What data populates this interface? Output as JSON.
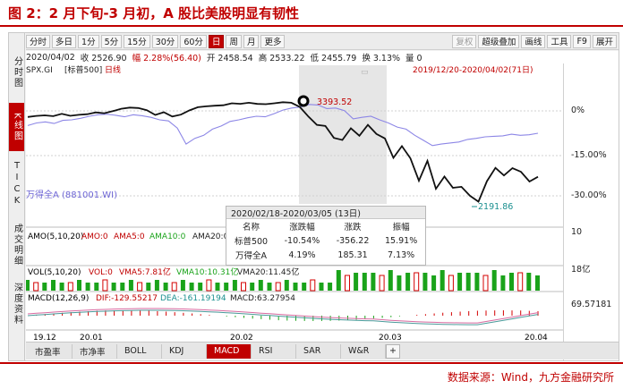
{
  "figure_title": "图 2：2 月下旬-3 月初，A 股比美股明显有韧性",
  "source": "数据来源：Wind，九方金融研究所",
  "sidebar": [
    {
      "label": "分时图",
      "active": false
    },
    {
      "label": "K线图",
      "active": true
    },
    {
      "label": "TICK",
      "active": false
    },
    {
      "label": "成交明细",
      "active": false
    },
    {
      "label": "深度资料",
      "active": false
    }
  ],
  "toolbar": {
    "left": [
      "分时",
      "多日",
      "1分",
      "5分",
      "15分",
      "30分",
      "60分",
      "日",
      "周",
      "月",
      "更多"
    ],
    "selected": "日",
    "right": [
      {
        "label": "复权",
        "disabled": true
      },
      {
        "label": "超级叠加",
        "disabled": false
      },
      {
        "label": "画线",
        "disabled": false
      },
      {
        "label": "工具",
        "disabled": false
      },
      {
        "label": "F9",
        "disabled": false
      },
      {
        "label": "展开",
        "disabled": false
      }
    ]
  },
  "info": {
    "date": "2020/04/02",
    "close": "收 2526.90",
    "change": "幅 2.28%(56.40)",
    "open": "开 2458.54",
    "high": "高 2533.22",
    "low": "低 2455.79",
    "turnover": "换 3.13%",
    "volume": "量 0"
  },
  "chart_header": {
    "series_id": "SPX.GI",
    "series_name": "[标普500]",
    "period": "日线",
    "range": "2019/12/20-2020/04/02(71日)"
  },
  "overlay_label": "万得全A (881001.WI)",
  "annotations": {
    "high": "3393.52",
    "low": "2191.86"
  },
  "right_axis": {
    "pct_ticks": [
      "0%",
      "-15.00%",
      "-30.00%"
    ],
    "vol_tick": "10",
    "vol_unit": "18亿",
    "macd_tick": "69.57181"
  },
  "amo_label": {
    "name": "AMO(5,10,20)",
    "amo0": "AMO:0",
    "amo5": "AMA5:0",
    "amo10": "AMA10:0",
    "amo20": "AMA20:0"
  },
  "vol_label": {
    "name": "VOL(5,10,20)",
    "vol0": "VOL:0",
    "vma5": "VMA5:7.81亿",
    "vma10": "VMA10:10.31亿",
    "vma20": "VMA20:11.45亿"
  },
  "macd_label": {
    "name": "MACD(12,26,9)",
    "dif": "DIF:-129.55217",
    "dea": "DEA:-161.19194",
    "macd": "MACD:63.27954"
  },
  "x_axis": [
    "19.12",
    "20.01",
    "20.02",
    "20.03",
    "20.04"
  ],
  "popup": {
    "title": "2020/02/18-2020/03/05 (13日)",
    "headers": [
      "名称",
      "涨跌幅",
      "涨跌",
      "振幅"
    ],
    "rows": [
      [
        "标普500",
        "-10.54%",
        "-356.22",
        "15.91%"
      ],
      [
        "万得全A",
        "4.19%",
        "185.31",
        "7.13%"
      ]
    ]
  },
  "bottom_tabs": [
    "市盈率",
    "市净率",
    "BOLL",
    "KDJ",
    "MACD",
    "RSI",
    "SAR",
    "W&R"
  ],
  "bottom_selected": "MACD",
  "colors": {
    "accent": "#c00000",
    "spx_line": "#111111",
    "wind_line": "#8c86e6",
    "vol_bar": "#1aa31a",
    "vol_bar_up": "#d40000",
    "selection": "#d6d6d6"
  },
  "chart_data": {
    "type": "line",
    "series": [
      {
        "name": "标普500",
        "values": [
          3221,
          3234,
          3240,
          3230,
          3257,
          3235,
          3246,
          3253,
          3274,
          3265,
          3289,
          3317,
          3330,
          3325,
          3300,
          3245,
          3276,
          3226,
          3248,
          3297,
          3334,
          3345,
          3352,
          3357,
          3380,
          3374,
          3386,
          3373,
          3370,
          3380,
          3393,
          3386,
          3337,
          3226,
          3128,
          3116,
          2978,
          2954,
          3090,
          3003,
          3130,
          3024,
          2972,
          2746,
          2882,
          2741,
          2480,
          2711,
          2386,
          2529,
          2398,
          2409,
          2305,
          2237,
          2475,
          2630,
          2541,
          2626,
          2584,
          2470,
          2526
        ]
      },
      {
        "name": "万得全A",
        "values": [
          4670,
          4720,
          4740,
          4710,
          4770,
          4780,
          4810,
          4850,
          4880,
          4890,
          4870,
          4840,
          4880,
          4860,
          4830,
          4780,
          4760,
          4620,
          4310,
          4420,
          4480,
          4600,
          4660,
          4750,
          4780,
          4820,
          4850,
          4840,
          4900,
          4970,
          5010,
          5030,
          5080,
          5070,
          5000,
          5010,
          4960,
          4800,
          4830,
          4850,
          4780,
          4720,
          4640,
          4600,
          4480,
          4380,
          4280,
          4310,
          4330,
          4350,
          4400,
          4420,
          4450,
          4460,
          4470,
          4500,
          4480,
          4490,
          4520
        ]
      }
    ]
  }
}
